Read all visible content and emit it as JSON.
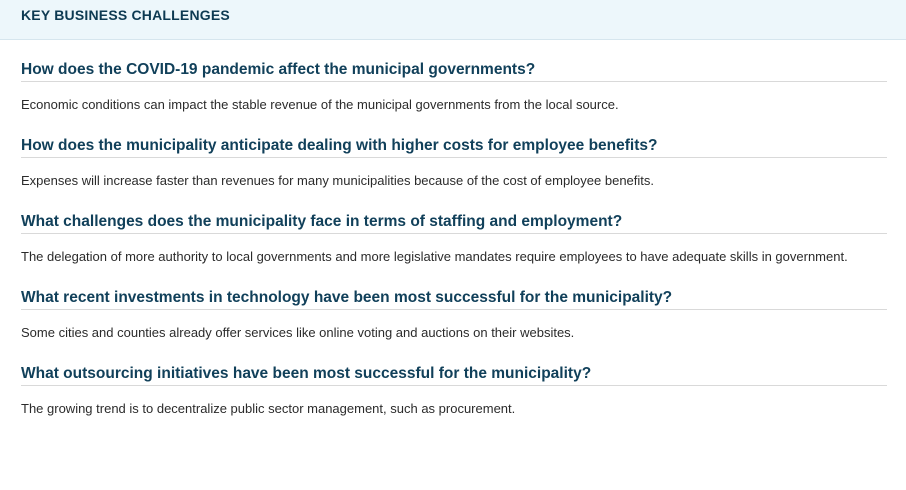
{
  "header": {
    "title": "KEY BUSINESS CHALLENGES"
  },
  "items": [
    {
      "question": "How does the COVID-19 pandemic affect the municipal governments?",
      "answer": "Economic conditions can impact the stable revenue of the municipal governments from the local source."
    },
    {
      "question": "How does the municipality anticipate dealing with higher costs for employee benefits?",
      "answer": "Expenses will increase faster than revenues for many municipalities because of the cost of employee benefits."
    },
    {
      "question": "What challenges does the municipality face in terms of staffing and employment?",
      "answer": "The delegation of more authority to local governments and more legislative mandates require employees to have adequate skills in government."
    },
    {
      "question": "What recent investments in technology have been most successful for the municipality?",
      "answer": "Some cities and counties already offer services like online voting and auctions on their websites."
    },
    {
      "question": "What outsourcing initiatives have been most successful for the municipality?",
      "answer": "The growing trend is to decentralize public sector management, such as procurement."
    }
  ]
}
